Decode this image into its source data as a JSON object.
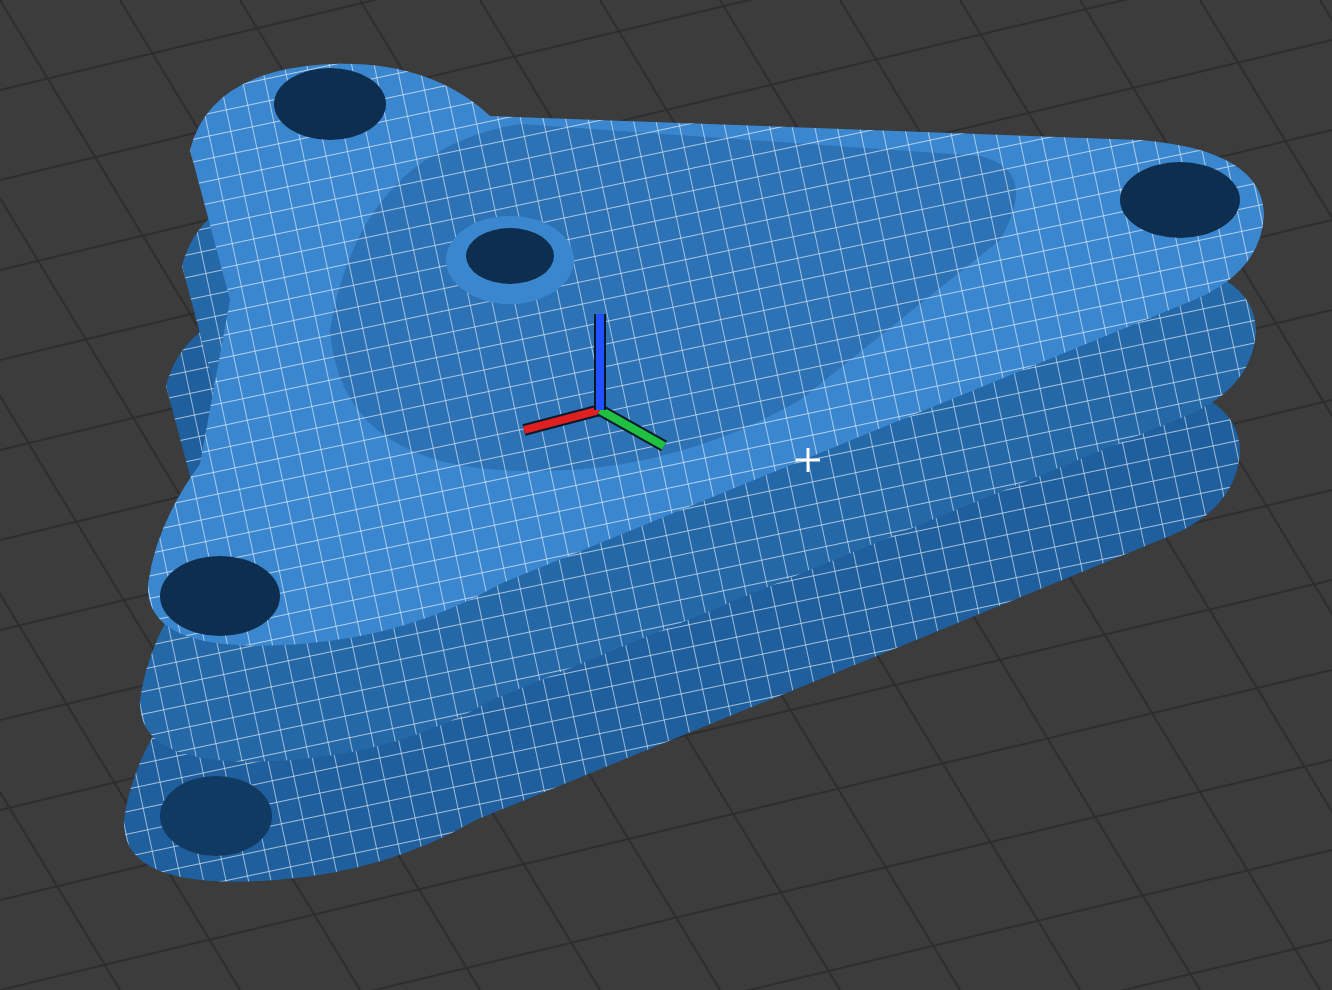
{
  "gizmo": {
    "axes": [
      {
        "color": "#e02020"
      },
      {
        "color": "#20c040"
      },
      {
        "color": "#2050ff"
      }
    ]
  }
}
